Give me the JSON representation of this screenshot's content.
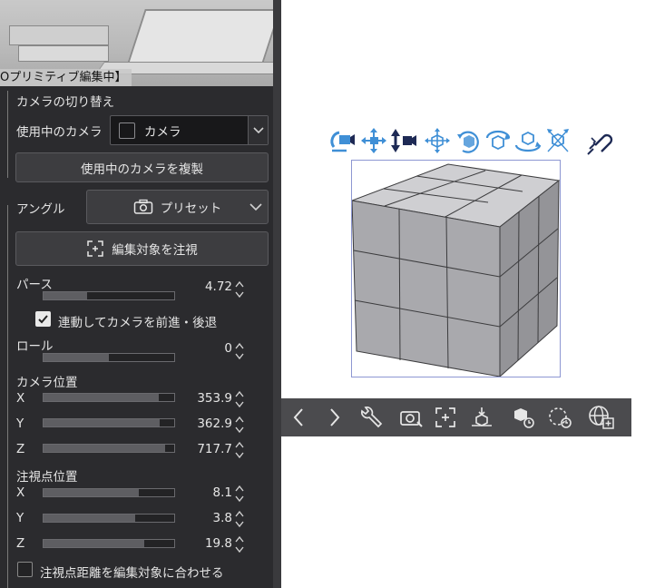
{
  "thumbnail": {
    "caption": "Oプリミティブ編集中】"
  },
  "camera_switch": {
    "section_label": "カメラの切り替え",
    "current_label": "使用中のカメラ",
    "current_value": "カメラ",
    "duplicate_button": "使用中のカメラを複製"
  },
  "angle": {
    "label": "アングル",
    "preset_label": "プリセット",
    "look_at_button": "編集対象を注視"
  },
  "perspective": {
    "label": "パース",
    "value": "4.72",
    "fill": 0.33
  },
  "move_with_camera": {
    "label": "連動してカメラを前進・後退",
    "checked": true
  },
  "roll": {
    "label": "ロール",
    "value": "0",
    "fill": 0.5
  },
  "camera_position": {
    "label": "カメラ位置",
    "x": {
      "label": "X",
      "value": "353.9",
      "fill": 0.88
    },
    "y": {
      "label": "Y",
      "value": "362.9",
      "fill": 0.89
    },
    "z": {
      "label": "Z",
      "value": "717.7",
      "fill": 0.93
    }
  },
  "target_position": {
    "label": "注視点位置",
    "x": {
      "label": "X",
      "value": "8.1",
      "fill": 0.73
    },
    "y": {
      "label": "Y",
      "value": "3.8",
      "fill": 0.7
    },
    "z": {
      "label": "Z",
      "value": "19.8",
      "fill": 0.77
    }
  },
  "fit_target_distance": {
    "label": "注視点距離を編集対象に合わせる",
    "checked": false
  },
  "colors": {
    "panel": "#2b2b2e",
    "manipulator_blue": "#3f8fd6",
    "cube_face": "#a9a9ad",
    "toolbar": "#4b4b4e"
  },
  "icons": {
    "manipulator": [
      "camera-rotate-icon",
      "camera-pan-icon",
      "camera-dolly-icon",
      "move-xy-icon",
      "rotate-axis-icon",
      "rotate-free-icon",
      "rotate-plane-icon",
      "rotate-flip-icon",
      "snap-magnet-icon"
    ],
    "toolbar": [
      "prev-icon",
      "next-icon",
      "wrench-icon",
      "camera-preset-icon",
      "focus-target-icon",
      "ground-icon",
      "object-list-icon",
      "reset-rotation-icon",
      "add-to-scene-icon"
    ]
  }
}
